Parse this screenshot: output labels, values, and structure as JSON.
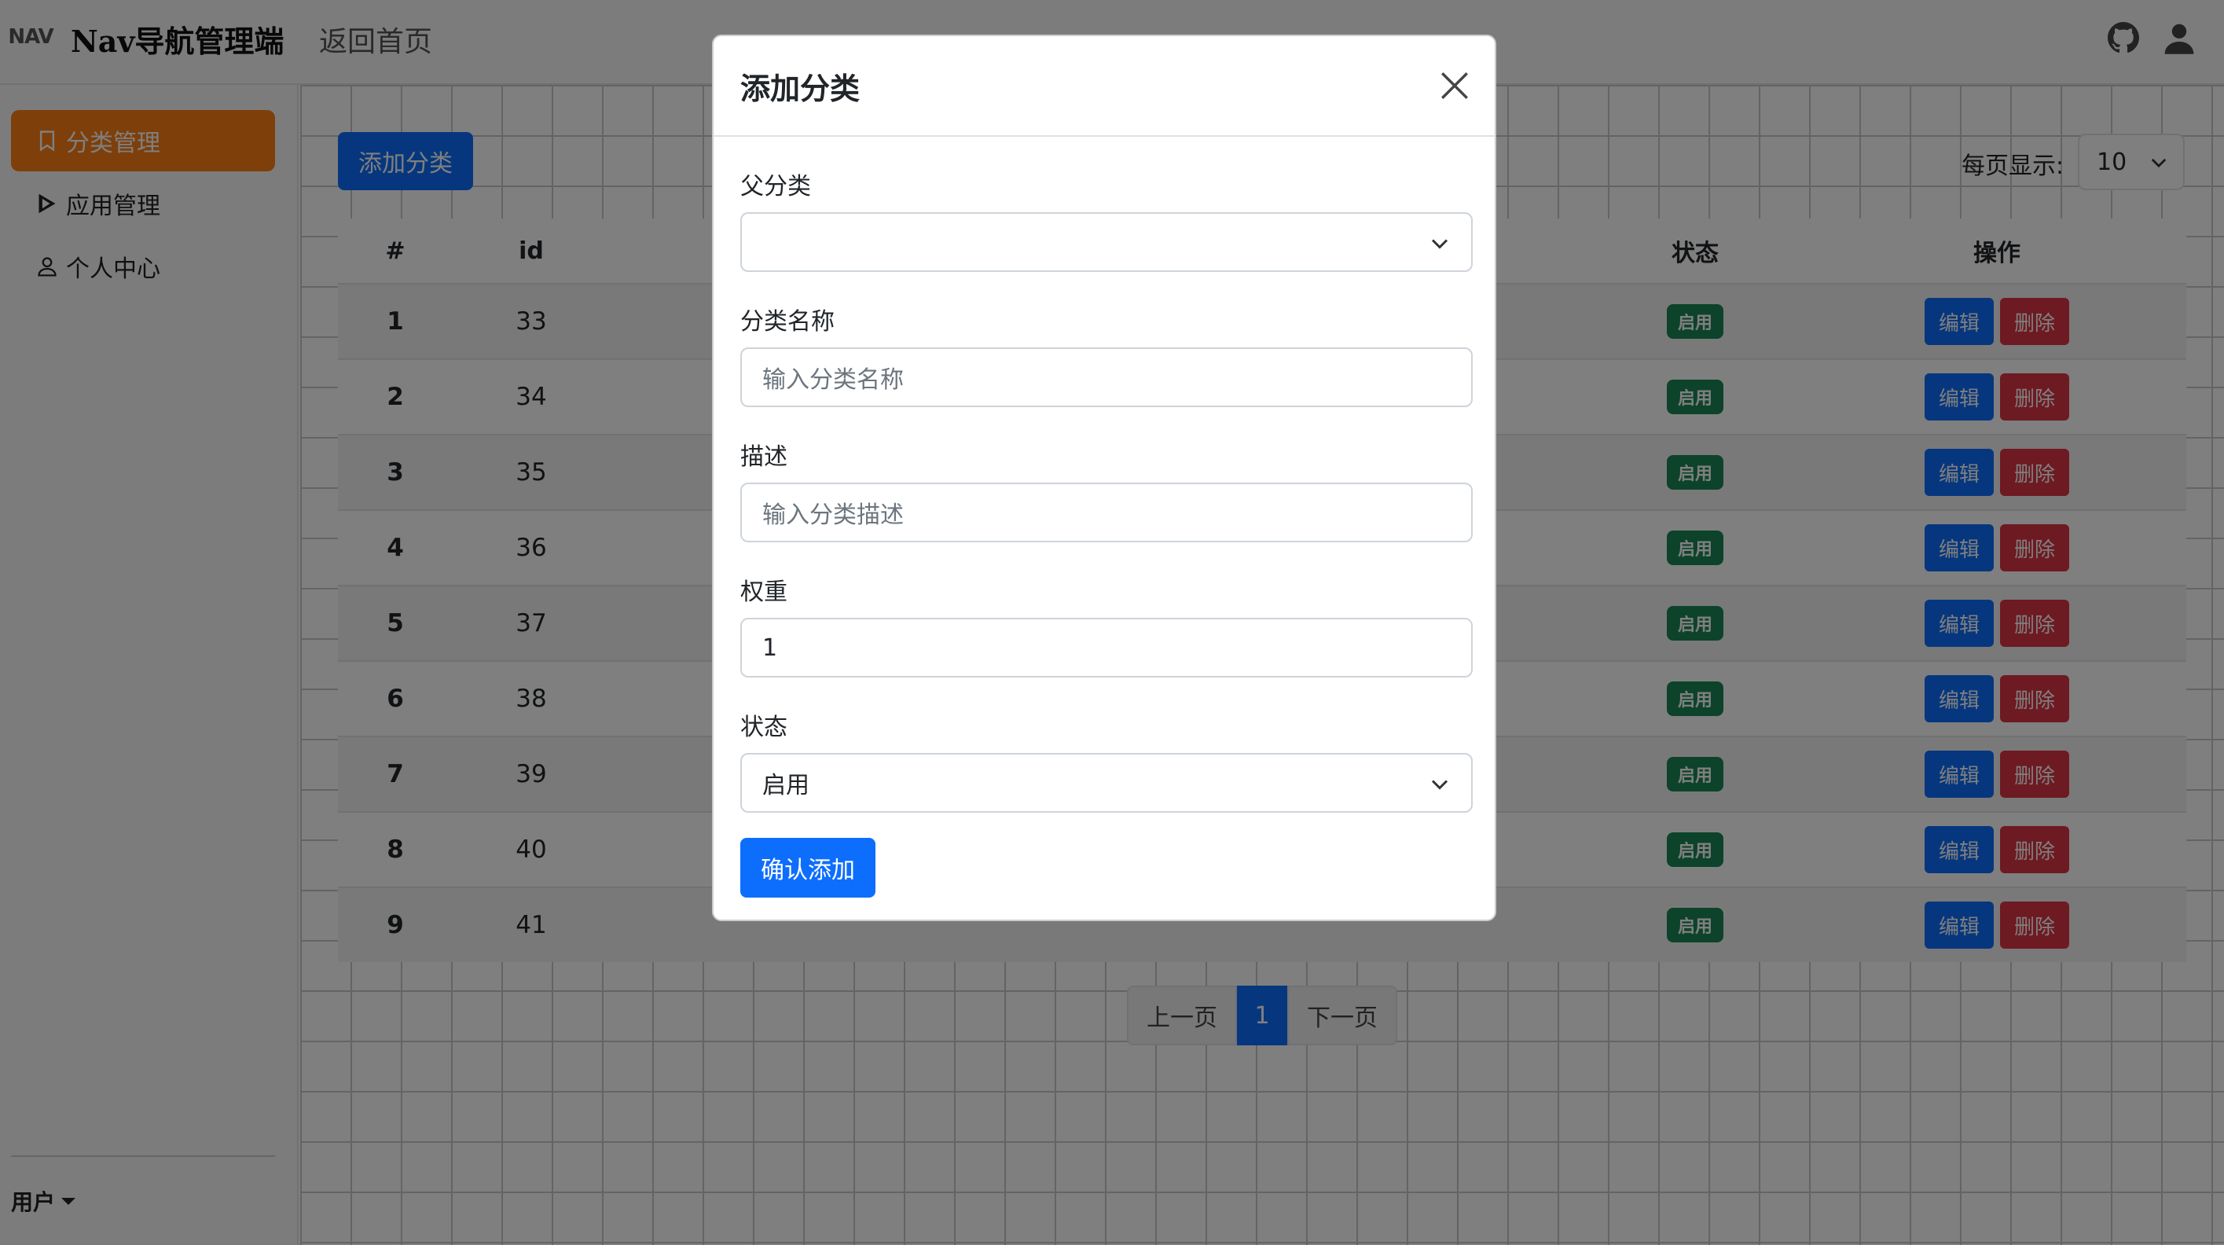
{
  "header": {
    "logo_text": "NAV",
    "brand": "Nav导航管理端",
    "home_link": "返回首页",
    "icons": [
      "github-icon",
      "user-icon"
    ]
  },
  "sidebar": {
    "items": [
      {
        "label": "分类管理",
        "icon": "bookmark-icon",
        "active": true
      },
      {
        "label": "应用管理",
        "icon": "play-icon",
        "active": false
      },
      {
        "label": "个人中心",
        "icon": "person-icon",
        "active": false
      }
    ],
    "user_label": "用户"
  },
  "toolbar": {
    "add_category_label": "添加分类",
    "per_page_label": "每页显示:",
    "per_page_value": "10"
  },
  "table": {
    "headers": [
      "#",
      "id",
      "状态",
      "操作"
    ],
    "rows": [
      {
        "num": "1",
        "id": "33",
        "status": "启用"
      },
      {
        "num": "2",
        "id": "34",
        "status": "启用"
      },
      {
        "num": "3",
        "id": "35",
        "status": "启用"
      },
      {
        "num": "4",
        "id": "36",
        "status": "启用"
      },
      {
        "num": "5",
        "id": "37",
        "status": "启用"
      },
      {
        "num": "6",
        "id": "38",
        "status": "启用"
      },
      {
        "num": "7",
        "id": "39",
        "status": "启用"
      },
      {
        "num": "8",
        "id": "40",
        "status": "启用"
      },
      {
        "num": "9",
        "id": "41",
        "status": "启用"
      }
    ],
    "edit_label": "编辑",
    "delete_label": "删除"
  },
  "pagination": {
    "prev_label": "上一页",
    "current_page": "1",
    "next_label": "下一页"
  },
  "modal": {
    "title": "添加分类",
    "fields": {
      "parent_label": "父分类",
      "parent_value": "",
      "name_label": "分类名称",
      "name_placeholder": "输入分类名称",
      "desc_label": "描述",
      "desc_placeholder": "输入分类描述",
      "weight_label": "权重",
      "weight_value": "1",
      "status_label": "状态",
      "status_value": "启用"
    },
    "confirm_label": "确认添加"
  },
  "colors": {
    "primary": "#0d6efd",
    "active_nav": "#fd7e14",
    "success": "#198754",
    "danger": "#dc3545"
  }
}
